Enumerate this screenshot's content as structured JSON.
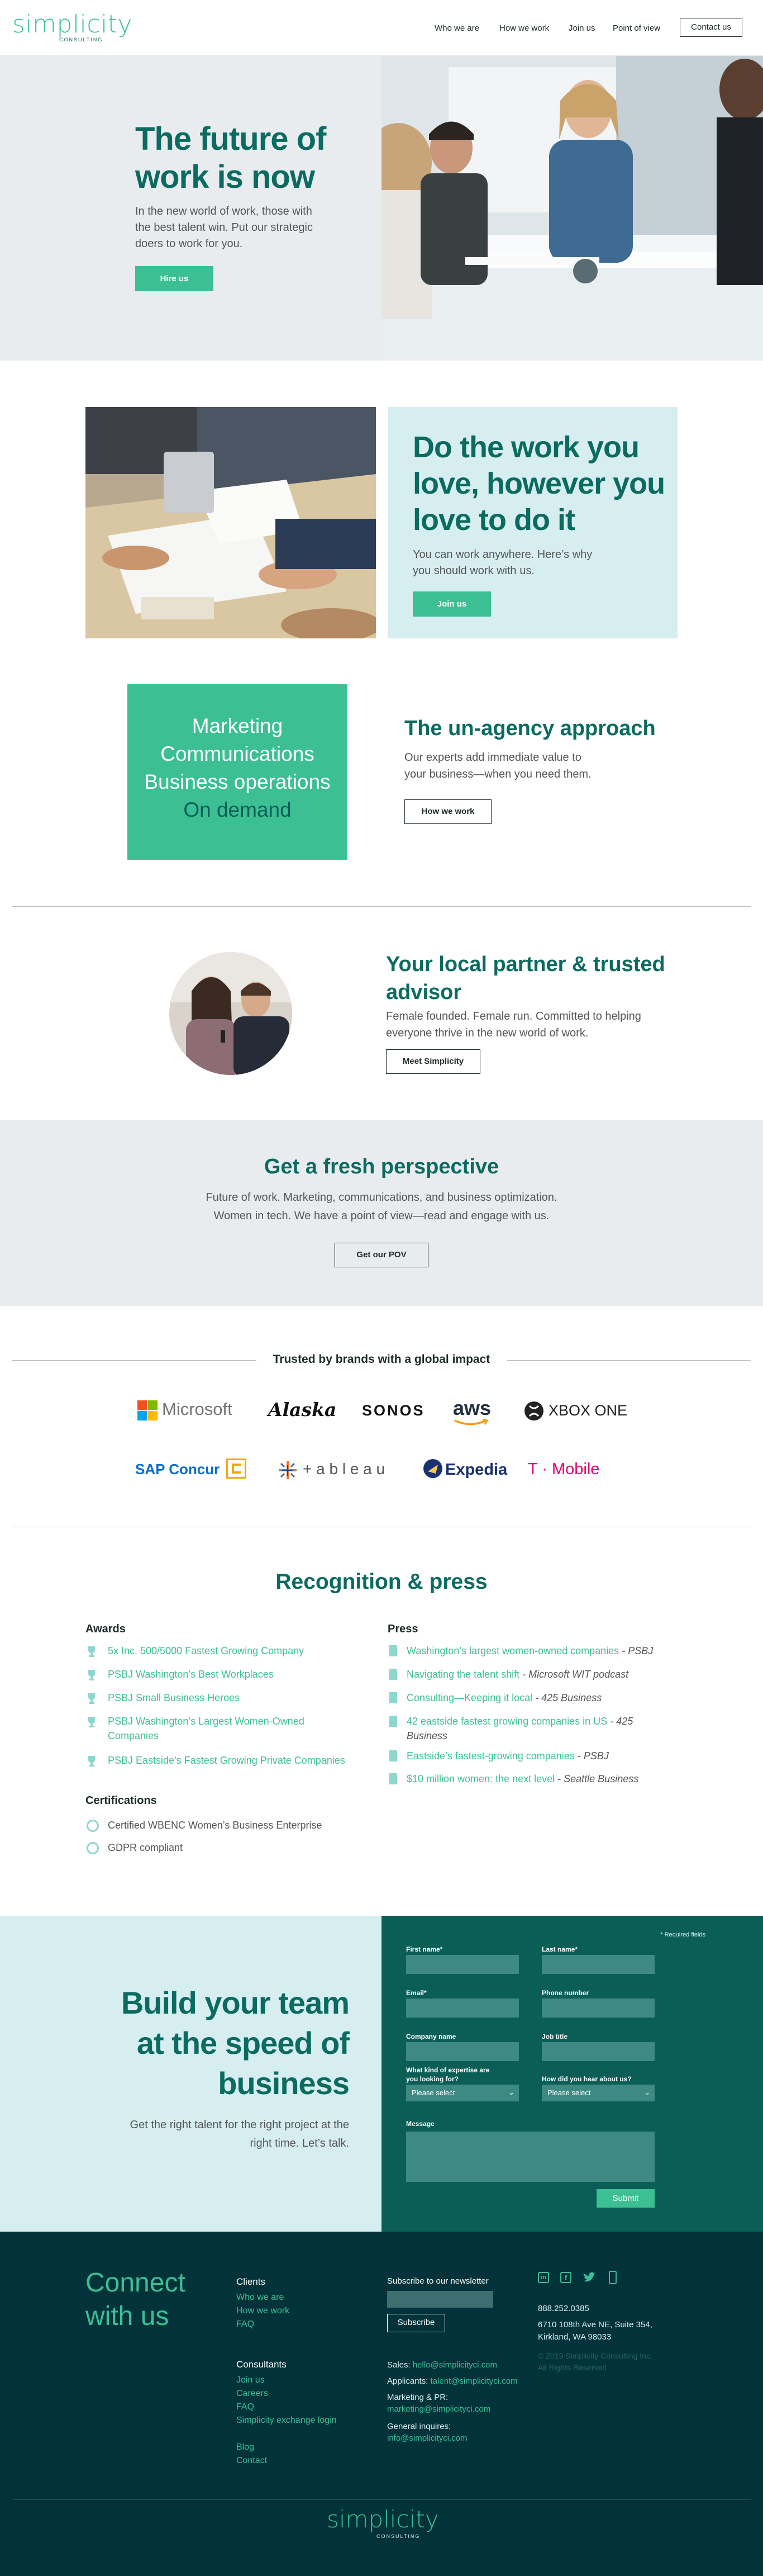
{
  "header": {
    "logo": "simplicity",
    "logo_sub": "CONSULTING",
    "nav": [
      "Who we are",
      "How we work",
      "Join us",
      "Point of view"
    ],
    "contact": "Contact us"
  },
  "hero": {
    "title_line1": "The future of",
    "title_line2": "work is now",
    "body_line1": "In the new world of work, those with",
    "body_line2": "the best talent win. Put our strategic",
    "body_line3": "doers to work for you.",
    "button": "Hire us"
  },
  "work": {
    "title_line1": "Do the work you",
    "title_line2": "love, however you",
    "title_line3": "love to do it",
    "body_line1": "You can work anywhere. Here’s why",
    "body_line2": "you should work with us.",
    "button": "Join us"
  },
  "ondemand": {
    "lines": [
      "Marketing",
      "Communications",
      "Business operations",
      "On demand"
    ],
    "title": "The un-agency approach",
    "body_line1": "Our experts add immediate value to",
    "body_line2": "your business—when you need them.",
    "button": "How we work"
  },
  "partner": {
    "title_line1": "Your local partner & trusted",
    "title_line2": "advisor",
    "body_line1": "Female founded. Female run. Committed to helping",
    "body_line2": "everyone thrive in the new world of work.",
    "button": "Meet Simplicity"
  },
  "perspective": {
    "title": "Get a fresh perspective",
    "body_line1": "Future of work. Marketing, communications, and business optimization.",
    "body_line2": "Women in tech. We have a point of view—read and engage with us.",
    "button": "Get our POV"
  },
  "trusted": {
    "heading": "Trusted by brands with a global impact",
    "logos": [
      "Microsoft",
      "Alaska",
      "SONOS",
      "aws",
      "XBOX ONE",
      "SAP Concur",
      "+ a b l e a u",
      "Expedia",
      "T · Mobile"
    ]
  },
  "recognition": {
    "title": "Recognition & press",
    "awards_heading": "Awards",
    "awards": [
      "5x Inc. 500/5000 Fastest Growing Company",
      "PSBJ Washington’s Best Workplaces",
      "PSBJ Small Business Heroes",
      "PSBJ Washington’s Largest Women-Owned",
      "Companies",
      "PSBJ Eastside’s Fastest Growing Private Companies"
    ],
    "press_heading": "Press",
    "press": [
      {
        "link": "Washington’s largest women-owned companies",
        "src": " - PSBJ"
      },
      {
        "link": "Navigating the talent shift",
        "src": " - Microsoft WIT podcast"
      },
      {
        "link": "Consulting—Keeping it local",
        "src": " - 425 Business"
      },
      {
        "link": "42 eastside fastest growing companies in US",
        "src": " - 425"
      },
      {
        "link": "",
        "src": "Business"
      },
      {
        "link": "Eastside’s fastest-growing companies",
        "src": " - PSBJ"
      },
      {
        "link": "$10 million women: the next level",
        "src": " - Seattle Business"
      }
    ],
    "cert_heading": "Certifications",
    "certs": [
      "Certified WBENC Women’s Business Enterprise",
      "GDPR compliant"
    ]
  },
  "build": {
    "title_line1": "Build your team",
    "title_line2": "at the speed of",
    "title_line3": "business",
    "body_line1": "Get the right talent for the right project at the",
    "body_line2": "right time. Let’s talk."
  },
  "form": {
    "required": "* Required fields",
    "first": "First name*",
    "last": "Last name*",
    "email": "Email*",
    "phone": "Phone number",
    "company": "Company name",
    "job": "Job title",
    "expertise_line1": "What kind of expertise are",
    "expertise_line2": "you looking for?",
    "hear": "How did you hear about us?",
    "select1": "Please select",
    "select2": "Please select",
    "message": "Message",
    "submit": "Submit"
  },
  "footer": {
    "connect_line1": "Connect",
    "connect_line2": "with us",
    "clients_heading": "Clients",
    "clients": [
      "Who we are",
      "How we work",
      "FAQ"
    ],
    "consultants_heading": "Consultants",
    "consultants": [
      "Join us",
      "Careers",
      "FAQ",
      "Simplicity exchange login"
    ],
    "extra": [
      "Blog",
      "Contact"
    ],
    "newsletter": "Subscribe to our newsletter",
    "subscribe": "Subscribe",
    "sales_label": "Sales: ",
    "sales_email": "hello@simplicityci.com",
    "applicants_label": "Applicants: ",
    "applicants_email": "talent@simplicityci.com",
    "marketing_label": "Marketing & PR:",
    "marketing_email": "marketing@simplicityci.com",
    "general_label": "General inquires:",
    "general_email": "info@simplicityci.com",
    "phone": "888.252.0385",
    "address_line1": "6710 108th Ave NE, Suite 354,",
    "address_line2": "Kirkland, WA 98033",
    "copyright_line1": "© 2019 Simplicity Consulting Inc.",
    "copyright_line2": "All Rights Reserved",
    "logo": "simplicity",
    "logo_sub": "CONSULTING"
  },
  "colors": {
    "brand_green": "#3dbf94",
    "dark_teal": "#0b6b61",
    "footer_bg": "#02333a",
    "light_blue": "#d7eef1"
  },
  "icons": [
    "linkedin-icon",
    "facebook-icon",
    "twitter-icon",
    "mobile-icon",
    "trophy-icon",
    "document-icon",
    "badge-icon"
  ]
}
